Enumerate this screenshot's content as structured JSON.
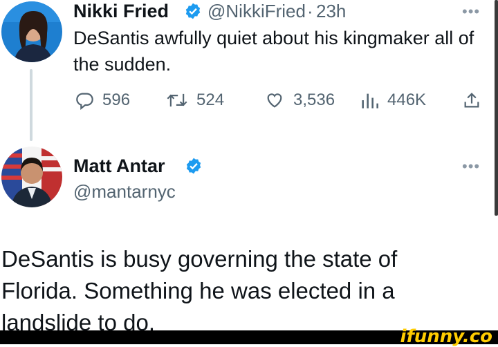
{
  "tweet": {
    "author_name": "Nikki Fried",
    "author_handle": "@NikkiFried",
    "separator": "·",
    "time": "23h",
    "text": "DeSantis awfully quiet about his kingmaker all of the sudden.",
    "actions": {
      "replies": "596",
      "retweets": "524",
      "likes": "3,536",
      "views": "446K"
    }
  },
  "reply": {
    "author_name": "Matt Antar",
    "author_handle": "@mantarnyc",
    "text": "DeSantis is busy governing the state of Florida. Something he was elected in a landslide to do."
  },
  "more_glyph": "•••",
  "watermark": "ifunny.co",
  "colors": {
    "verified": "#1d9bf0",
    "secondary_text": "#536471",
    "thread_line": "#cfd9de",
    "watermark": "#ffcc00"
  },
  "icons": [
    "reply-icon",
    "retweet-icon",
    "like-icon",
    "views-icon",
    "share-icon",
    "verified-badge-icon",
    "more-icon"
  ]
}
